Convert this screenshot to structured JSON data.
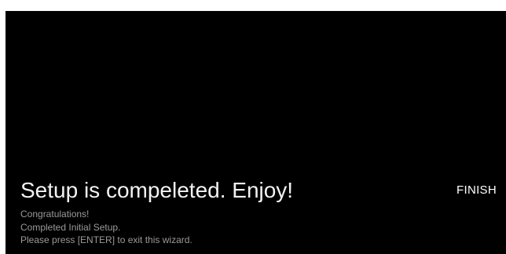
{
  "wizard": {
    "title": "Setup is compeleted. Enjoy!",
    "finish_label": "FINISH",
    "messages": [
      "Congratulations!",
      "Completed Initial Setup.",
      "Please press [ENTER] to exit this wizard."
    ]
  },
  "colors": {
    "background": "#000000",
    "title_text": "#f2f2f2",
    "message_text": "#9a9a9a",
    "button_text": "#ffffff"
  }
}
